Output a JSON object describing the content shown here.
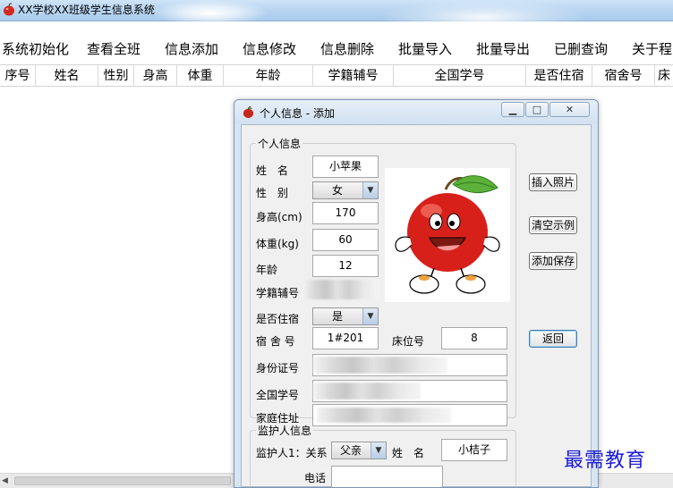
{
  "window": {
    "title": "XX学校XX班级学生信息系统"
  },
  "menu": [
    "系统初始化",
    "查看全班",
    "信息添加",
    "信息修改",
    "信息删除",
    "批量导入",
    "批量导出",
    "已删查询",
    "关于程"
  ],
  "grid": {
    "columns": [
      "序号",
      "姓名",
      "性别",
      "身高",
      "体重",
      "年龄",
      "学籍辅号",
      "全国学号",
      "是否住宿",
      "宿舍号",
      "床"
    ]
  },
  "dialog": {
    "title": "个人信息 - 添加",
    "info_group": "个人信息",
    "fields": {
      "name_label": "姓　名",
      "name_value": "小苹果",
      "gender_label": "性　别",
      "gender_value": "女",
      "height_label": "身高(cm)",
      "height_value": "170",
      "weight_label": "体重(kg)",
      "weight_value": "60",
      "age_label": "年龄",
      "age_value": "12",
      "school_id_label": "学籍辅号",
      "boarding_label": "是否住宿",
      "boarding_value": "是",
      "dorm_label": "宿 舍 号",
      "dorm_value": "1#201",
      "bed_label": "床位号",
      "bed_value": "8",
      "id_card_label": "身份证号",
      "national_id_label": "全国学号",
      "address_label": "家庭住址"
    },
    "buttons": {
      "insert_photo": "插入照片",
      "clear_example": "清空示例",
      "add_save": "添加保存",
      "back": "返回"
    },
    "guardian_group": "监护人信息",
    "guardian": {
      "relation_label": "监护人1：关系",
      "relation_value": "父亲",
      "name_label": "姓　名",
      "name_value": "小桔子",
      "phone_label": "电话"
    }
  },
  "watermark": "最需教育",
  "colors": {
    "titlebar": "#b9d6f1",
    "dialog_frame": "#d7e4f2",
    "watermark": "#1b1bd6"
  }
}
